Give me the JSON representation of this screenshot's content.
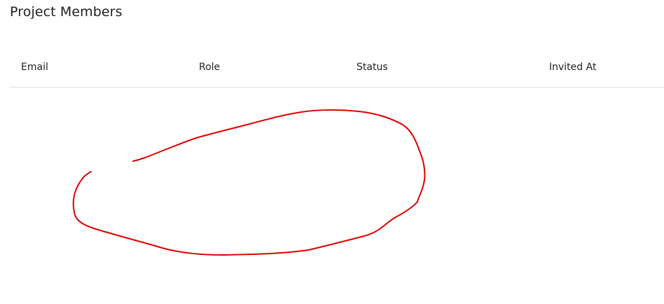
{
  "page": {
    "title": "Project Members"
  },
  "table": {
    "columns": [
      "Email",
      "Role",
      "Status",
      "Invited At"
    ],
    "rows": []
  },
  "colors": {
    "text": "#212121",
    "divider": "#e0e0e0",
    "annotation": "#e00000"
  }
}
